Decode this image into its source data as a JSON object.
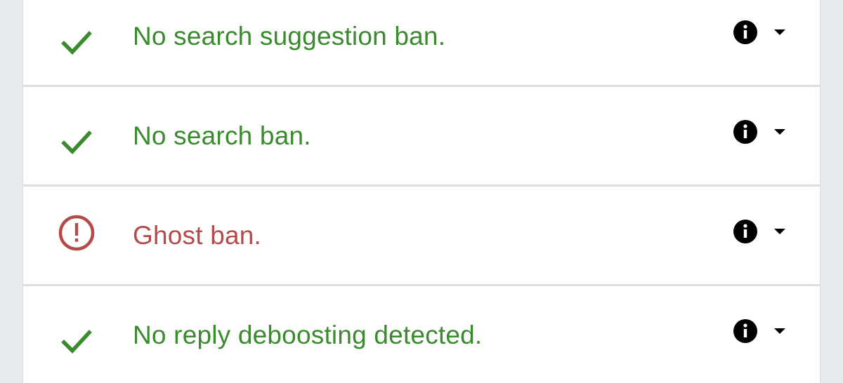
{
  "colors": {
    "ok": "#3a8a2e",
    "alert": "#b54a4a",
    "icon": "#000000",
    "background": "#e7eaed",
    "card": "#ffffff",
    "divider": "#dddddd"
  },
  "results": [
    {
      "status": "ok",
      "status_icon": "check-icon",
      "text": "No search suggestion ban."
    },
    {
      "status": "ok",
      "status_icon": "check-icon",
      "text": "No search ban."
    },
    {
      "status": "alert",
      "status_icon": "alert-circle-icon",
      "text": "Ghost ban."
    },
    {
      "status": "ok",
      "status_icon": "check-icon",
      "text": "No reply deboosting detected."
    }
  ],
  "row_actions": {
    "info_icon": "info-icon",
    "dropdown_icon": "caret-down-icon"
  }
}
